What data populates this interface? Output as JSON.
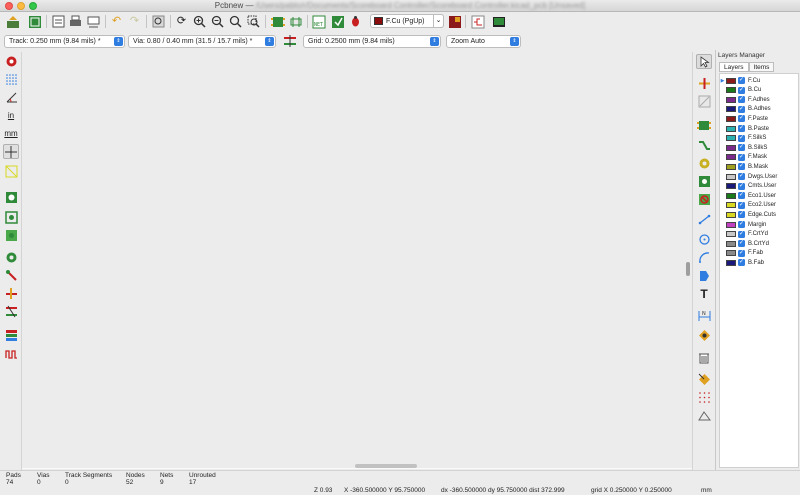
{
  "window": {
    "app_name": "Pcbnew",
    "separator": " — ",
    "path": "/Users/pablo/r/Documents/Scoreboard Controller/Scoreboard Controller.kicad_pcb [Unsaved]"
  },
  "toolbar": {
    "active_layer": "F.Cu (PgUp)",
    "track": "Track: 0.250 mm (9.84 mils) *",
    "via": "Via: 0.80 / 0.40 mm (31.5 / 15.7 mils) *",
    "grid": "Grid: 0.2500 mm (9.84 mils)",
    "zoom": "Zoom Auto"
  },
  "left_toolbar": {
    "units_inch": "in",
    "units_mm": "mm"
  },
  "layers_manager": {
    "title": "Layers Manager",
    "tabs": [
      "Layers",
      "Items"
    ],
    "layers": [
      {
        "name": "F.Cu",
        "color": "#8b1a1a",
        "active": true
      },
      {
        "name": "B.Cu",
        "color": "#1a7a1a"
      },
      {
        "name": "F.Adhes",
        "color": "#7a2a8a"
      },
      {
        "name": "B.Adhes",
        "color": "#1a1a7a"
      },
      {
        "name": "F.Paste",
        "color": "#8b1a1a"
      },
      {
        "name": "B.Paste",
        "color": "#2ab0b0"
      },
      {
        "name": "F.SilkS",
        "color": "#2ab0b0"
      },
      {
        "name": "B.SilkS",
        "color": "#7a2a8a"
      },
      {
        "name": "F.Mask",
        "color": "#7a2a8a"
      },
      {
        "name": "B.Mask",
        "color": "#a0a020"
      },
      {
        "name": "Dwgs.User",
        "color": "#c8c8c8"
      },
      {
        "name": "Cmts.User",
        "color": "#1a1a7a"
      },
      {
        "name": "Eco1.User",
        "color": "#1a7a1a"
      },
      {
        "name": "Eco2.User",
        "color": "#d8d820"
      },
      {
        "name": "Edge.Cuts",
        "color": "#d8d820"
      },
      {
        "name": "Margin",
        "color": "#c040c0"
      },
      {
        "name": "F.CrtYd",
        "color": "#c8c8c8"
      },
      {
        "name": "B.CrtYd",
        "color": "#8a8a8a"
      },
      {
        "name": "F.Fab",
        "color": "#8a8a8a"
      },
      {
        "name": "B.Fab",
        "color": "#1a1a7a"
      }
    ]
  },
  "status": {
    "stats": [
      {
        "label": "Pads",
        "value": "74"
      },
      {
        "label": "Vias",
        "value": "0"
      },
      {
        "label": "Track Segments",
        "value": "0"
      },
      {
        "label": "Nodes",
        "value": "52"
      },
      {
        "label": "Nets",
        "value": "9"
      },
      {
        "label": "Unrouted",
        "value": "17"
      }
    ],
    "zoom": "Z 0.93",
    "xy": "X -360.500000  Y 95.750000",
    "dxdy": "dx -360.500000  dy 95.750000  dist 372.999",
    "grid": "grid X 0.250000  Y 0.250000",
    "units": "mm"
  }
}
